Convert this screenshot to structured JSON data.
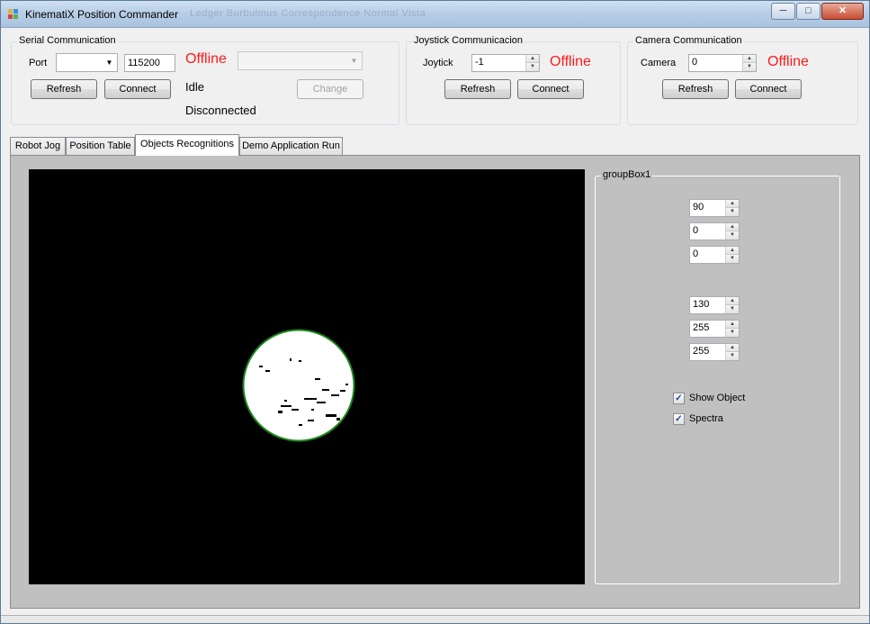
{
  "window": {
    "title": "KinematiX Position Commander",
    "faded_title": "Ledger   Burbulmus   Correspondence   Normal   Vista",
    "minimize": "─",
    "maximize": "□",
    "close": "✕"
  },
  "serial": {
    "group_title": "Serial Communication",
    "port_label": "Port",
    "port_value": "",
    "baud_value": "115200",
    "status": "Offline",
    "refresh": "Refresh",
    "connect": "Connect",
    "state": "Idle",
    "connection": "Disconnected",
    "change": "Change",
    "device_value": ""
  },
  "joystick": {
    "group_title": "Joystick Communicacion",
    "label": "Joytick",
    "value": "-1",
    "status": "Offline",
    "refresh": "Refresh",
    "connect": "Connect"
  },
  "camera": {
    "group_title": "Camera Communication",
    "label": "Camera",
    "value": "0",
    "status": "Offline",
    "refresh": "Refresh",
    "connect": "Connect"
  },
  "tabs": [
    {
      "label": "Robot Jog"
    },
    {
      "label": "Position Table"
    },
    {
      "label": "Objects Recognitions"
    },
    {
      "label": "Demo Application Run"
    }
  ],
  "active_tab": "Objects Recognitions",
  "groupbox1": {
    "title": "groupBox1",
    "lower": [
      "90",
      "0",
      "0"
    ],
    "upper": [
      "130",
      "255",
      "255"
    ],
    "show_object": {
      "label": "Show Object",
      "checked": true
    },
    "spectra": {
      "label": "Spectra",
      "checked": true
    }
  },
  "colors": {
    "status_red": "#ff1a1a",
    "detection_circle": "#1a8a1a",
    "image_bg": "#000000",
    "tab_page_bg": "#c0c0c0"
  }
}
